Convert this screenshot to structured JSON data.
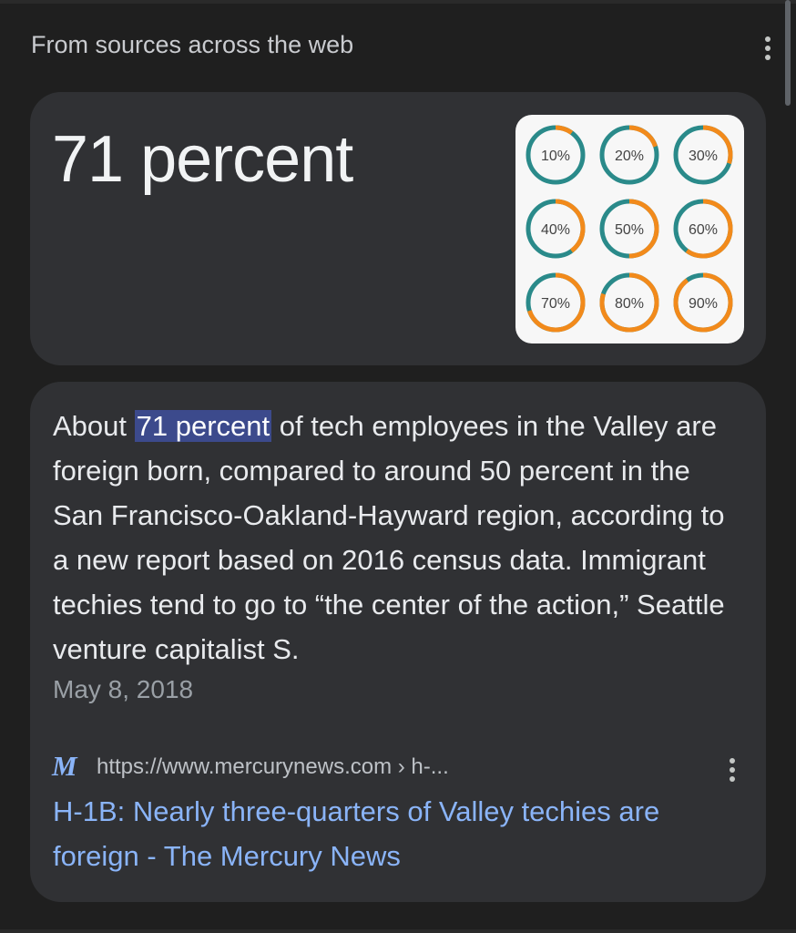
{
  "header": {
    "title": "From sources across the web",
    "menu_icon": "more-vert-icon"
  },
  "answer_card": {
    "answer": "71 percent",
    "thumbnail": {
      "labels": [
        "10%",
        "20%",
        "30%",
        "40%",
        "50%",
        "60%",
        "70%",
        "80%",
        "90%"
      ],
      "values": [
        0.1,
        0.2,
        0.3,
        0.4,
        0.5,
        0.6,
        0.7,
        0.8,
        0.9
      ],
      "colors": {
        "fill": "#f28a1b",
        "track": "#2a8a8a"
      }
    }
  },
  "snippet_card": {
    "text_before": "About ",
    "highlight": "71 percent",
    "text_after": " of tech employees in the Valley are foreign born, compared to around 50 percent in the San Francisco-Oakland-Hayward region, according to a new report based on 2016 census data. Immigrant techies tend to go to “the center of the action,” Seattle venture capitalist S.",
    "date": "May 8, 2018",
    "source": {
      "favicon_letter": "M",
      "url": "https://www.mercurynews.com › h-...",
      "title": "H-1B: Nearly three-quarters of Valley techies are foreign - The Mercury News",
      "menu_icon": "more-vert-icon"
    }
  },
  "colors": {
    "background": "#1f1f1f",
    "card": "#303134",
    "link": "#8ab4f8",
    "highlight": "#3c4a8c"
  }
}
